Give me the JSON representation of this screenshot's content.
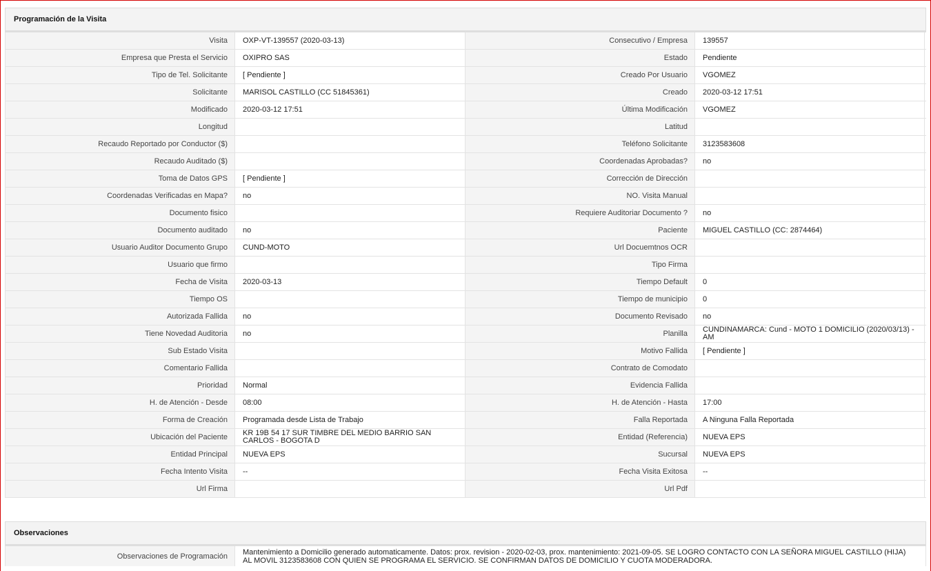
{
  "programacion": {
    "title": "Programación de la Visita",
    "rows": [
      [
        "Visita",
        "OXP-VT-139557 (2020-03-13)",
        "Consecutivo / Empresa",
        "139557"
      ],
      [
        "Empresa que Presta el Servicio",
        "OXIPRO SAS",
        "Estado",
        "Pendiente"
      ],
      [
        "Tipo de Tel. Solicitante",
        "[ Pendiente ]",
        "Creado Por Usuario",
        "VGOMEZ"
      ],
      [
        "Solicitante",
        "MARISOL CASTILLO (CC 51845361)",
        "Creado",
        "2020-03-12 17:51"
      ],
      [
        "Modificado",
        "2020-03-12 17:51",
        "Última Modificación",
        " VGOMEZ"
      ],
      [
        "Longitud",
        "",
        "Latitud",
        ""
      ],
      [
        "Recaudo Reportado por Conductor ($)",
        "",
        "Teléfono Solicitante",
        "3123583608"
      ],
      [
        "Recaudo Auditado ($)",
        "",
        "Coordenadas Aprobadas?",
        " no"
      ],
      [
        "Toma de Datos GPS",
        "[ Pendiente ]",
        "Corrección de Dirección",
        ""
      ],
      [
        "Coordenadas Verificadas en Mapa?",
        " no",
        "NO. Visita Manual",
        ""
      ],
      [
        "Documento fisico",
        "",
        "Requiere Auditoriar Documento ?",
        " no"
      ],
      [
        "Documento auditado",
        " no",
        "Paciente",
        "MIGUEL CASTILLO (CC: 2874464)"
      ],
      [
        "Usuario Auditor Documento Grupo",
        "CUND-MOTO",
        "Url Docuemtnos OCR",
        ""
      ],
      [
        "Usuario que firmo",
        "",
        "Tipo Firma",
        ""
      ],
      [
        "Fecha de Visita",
        " 2020-03-13",
        "Tiempo Default",
        "0"
      ],
      [
        "Tiempo OS",
        "",
        "Tiempo de municipio",
        "0"
      ],
      [
        "Autorizada Fallida",
        " no",
        "Documento Revisado",
        " no"
      ],
      [
        "Tiene Novedad Auditoria",
        " no",
        "Planilla",
        "CUNDINAMARCA: Cund - MOTO 1 DOMICILIO (2020/03/13) - AM"
      ],
      [
        "Sub Estado Visita",
        "",
        "Motivo Fallida",
        "[ Pendiente ]"
      ],
      [
        "Comentario Fallida",
        "",
        "Contrato de Comodato",
        ""
      ],
      [
        "Prioridad",
        "Normal",
        "Evidencia Fallida",
        ""
      ],
      [
        "H. de Atención - Desde",
        "08:00",
        "H. de Atención - Hasta",
        "17:00"
      ],
      [
        "Forma de Creación",
        "Programada desde Lista de Trabajo",
        "Falla Reportada",
        "A Ninguna Falla Reportada"
      ],
      [
        "Ubicación del Paciente",
        "KR 19B 54 17 SUR TIMBRE DEL MEDIO BARRIO SAN CARLOS - BOGOTA D",
        "Entidad (Referencia)",
        "NUEVA EPS"
      ],
      [
        "Entidad Principal",
        "NUEVA EPS",
        "Sucursal",
        "NUEVA EPS"
      ],
      [
        "Fecha Intento Visita",
        " --",
        "Fecha Visita Exitosa",
        " --"
      ],
      [
        "Url Firma",
        "",
        "Url Pdf",
        ""
      ]
    ]
  },
  "observaciones": {
    "title": "Observaciones",
    "label": "Observaciones de Programación",
    "value": " Mantenimiento a Domicilio generado automaticamente. Datos: prox. revision - 2020-02-03, prox. mantenimiento: 2021-09-05. SE LOGRO CONTACTO CON LA SEÑORA MIGUEL CASTILLO (HIJA) AL MOVIL 3123583608 CON QUIEN SE PROGRAMA EL SERVICIO. SE CONFIRMAN DATOS DE DOMICILIO Y CUOTA MODERADORA."
  }
}
